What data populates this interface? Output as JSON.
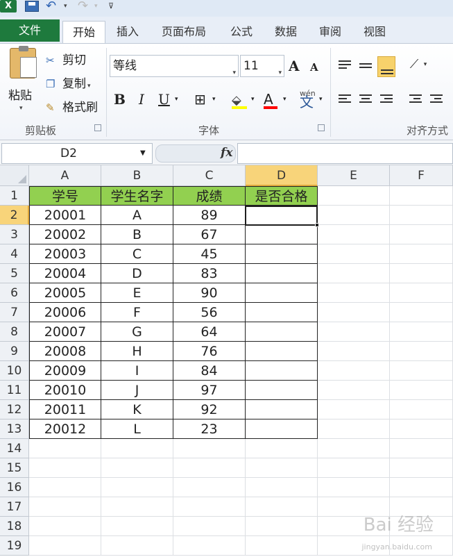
{
  "qat": {
    "undo_arrow": "▾",
    "redo_arrow": "▾",
    "customize": "⊽"
  },
  "tabs": {
    "file": "文件",
    "items": [
      "开始",
      "插入",
      "页面布局",
      "公式",
      "数据",
      "审阅",
      "视图"
    ],
    "active": "开始"
  },
  "ribbon": {
    "clipboard": {
      "paste": "粘贴",
      "cut": "剪切",
      "copy": "复制",
      "format_painter": "格式刷",
      "group_label": "剪贴板"
    },
    "font": {
      "font_name": "等线",
      "font_size": "11",
      "bold": "B",
      "italic": "I",
      "underline": "U",
      "font_color_glyph": "A",
      "phonetic_glyph": "wén",
      "phonetic_char": "文",
      "group_label": "字体",
      "grow": "A",
      "shrink": "A"
    },
    "alignment": {
      "group_label": "对齐方式"
    }
  },
  "formula_bar": {
    "name_box": "D2",
    "fx": "fx",
    "formula": ""
  },
  "grid": {
    "columns": [
      "A",
      "B",
      "C",
      "D",
      "E",
      "F"
    ],
    "rows": [
      1,
      2,
      3,
      4,
      5,
      6,
      7,
      8,
      9,
      10,
      11,
      12,
      13,
      14,
      15,
      16,
      17,
      18,
      19
    ],
    "header": [
      "学号",
      "学生名字",
      "成绩",
      "是否合格"
    ],
    "data": [
      [
        "20001",
        "A",
        "89",
        ""
      ],
      [
        "20002",
        "B",
        "67",
        ""
      ],
      [
        "20003",
        "C",
        "45",
        ""
      ],
      [
        "20004",
        "D",
        "83",
        ""
      ],
      [
        "20005",
        "E",
        "90",
        ""
      ],
      [
        "20006",
        "F",
        "56",
        ""
      ],
      [
        "20007",
        "G",
        "64",
        ""
      ],
      [
        "20008",
        "H",
        "76",
        ""
      ],
      [
        "20009",
        "I",
        "84",
        ""
      ],
      [
        "20010",
        "J",
        "97",
        ""
      ],
      [
        "20011",
        "K",
        "92",
        ""
      ],
      [
        "20012",
        "L",
        "23",
        ""
      ]
    ],
    "selected_cell": "D2",
    "header_fill": "#92d050",
    "selection_accent": "#f8d47a"
  },
  "watermark": {
    "brand": "Bai 经验",
    "url": "jingyan.baidu.com"
  }
}
